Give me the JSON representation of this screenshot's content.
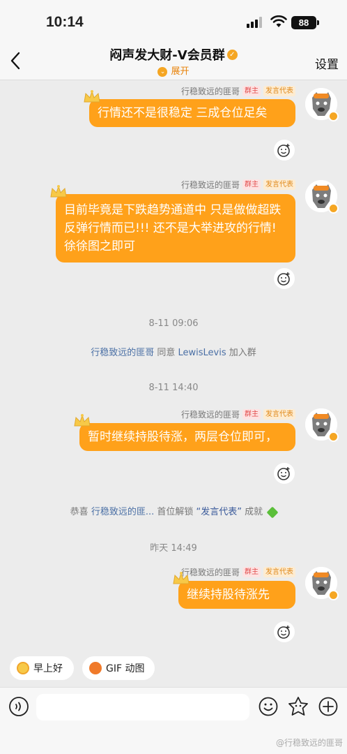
{
  "status_bar": {
    "time": "10:14",
    "battery": "88"
  },
  "nav": {
    "title": "闷声发大财-V会员群",
    "expand_label": "展开",
    "settings_label": "设置"
  },
  "sender": {
    "name": "行稳致远的匪哥",
    "tag_owner": "群主",
    "tag_rep": "发言代表"
  },
  "messages": [
    {
      "text": "行情还不是很稳定  三成仓位足矣"
    },
    {
      "text": "目前毕竟是下跌趋势通道中  只是做做超跌反弹行情而已!!!  还不是大举进攻的行情!   徐徐图之即可"
    },
    {
      "text": "暂时继续持股待涨，两层仓位即可，"
    },
    {
      "text": "继续持股待涨先"
    }
  ],
  "system": {
    "time1": "8-11 09:06",
    "join": {
      "actor": "行稳致远的匪哥",
      "verb": "同意",
      "user": "LewisLevis",
      "suffix": "加入群"
    },
    "time2": "8-11 14:40",
    "achievement": {
      "prefix": "恭喜",
      "actor": "行稳致远的匪...",
      "middle": "首位解锁",
      "badge": "“发言代表”",
      "suffix": "成就"
    },
    "time3": "昨天 14:49"
  },
  "quick_replies": [
    {
      "label": "早上好"
    },
    {
      "label": "GIF 动图"
    }
  ],
  "watermark": "@行稳致远的匪哥",
  "colors": {
    "bubble": "#ffa11a",
    "accent": "#e8830b"
  }
}
